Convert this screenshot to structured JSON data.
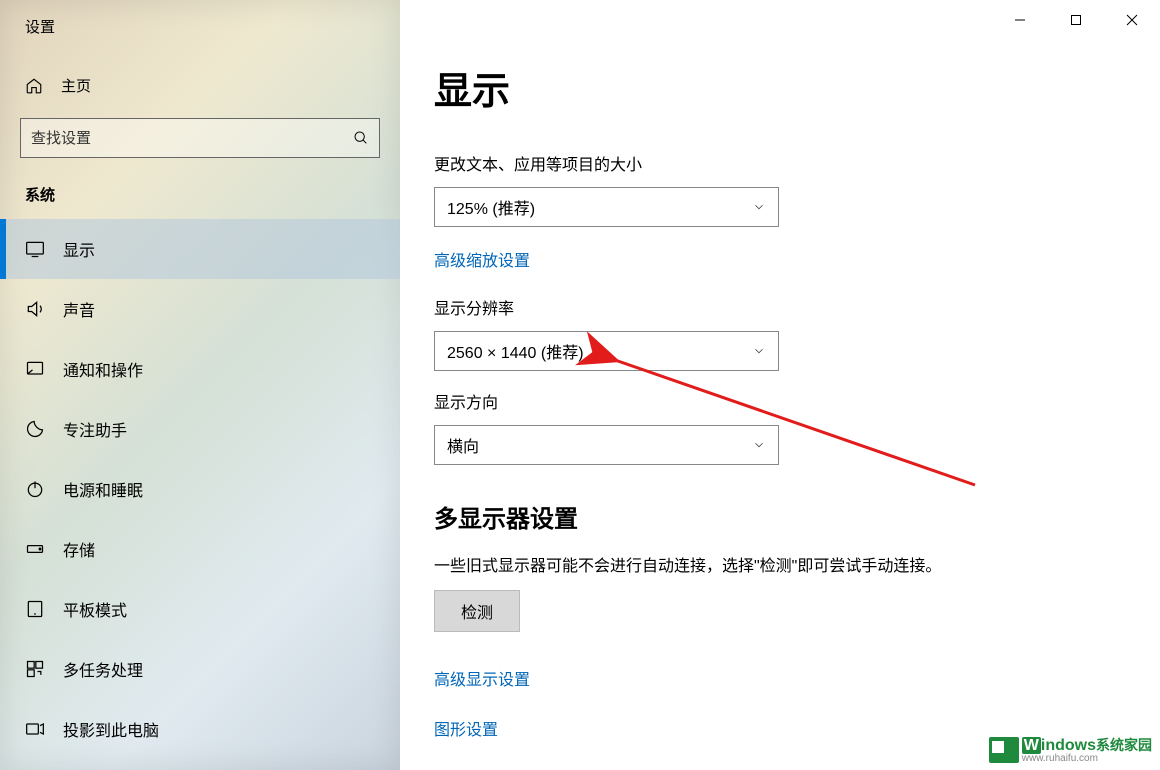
{
  "window": {
    "title": "设置"
  },
  "sidebar": {
    "home": "主页",
    "search_placeholder": "查找设置",
    "section": "系统",
    "items": [
      {
        "icon": "display",
        "label": "显示",
        "selected": true
      },
      {
        "icon": "sound",
        "label": "声音"
      },
      {
        "icon": "notifications",
        "label": "通知和操作"
      },
      {
        "icon": "focus",
        "label": "专注助手"
      },
      {
        "icon": "power",
        "label": "电源和睡眠"
      },
      {
        "icon": "storage",
        "label": "存储"
      },
      {
        "icon": "tablet",
        "label": "平板模式"
      },
      {
        "icon": "multitask",
        "label": "多任务处理"
      },
      {
        "icon": "project",
        "label": "投影到此电脑"
      }
    ]
  },
  "main": {
    "heading": "显示",
    "scale_label": "更改文本、应用等项目的大小",
    "scale_value": "125% (推荐)",
    "advanced_scale_link": "高级缩放设置",
    "resolution_label": "显示分辨率",
    "resolution_value": "2560 × 1440 (推荐)",
    "orientation_label": "显示方向",
    "orientation_value": "横向",
    "multi_heading": "多显示器设置",
    "multi_desc": "一些旧式显示器可能不会进行自动连接，选择\"检测\"即可尝试手动连接。",
    "detect_btn": "检测",
    "advanced_display_link": "高级显示设置",
    "graphics_link": "图形设置"
  },
  "watermark": {
    "brand": "indows",
    "sub": "系统家园",
    "url": "www.ruhaifu.com"
  }
}
